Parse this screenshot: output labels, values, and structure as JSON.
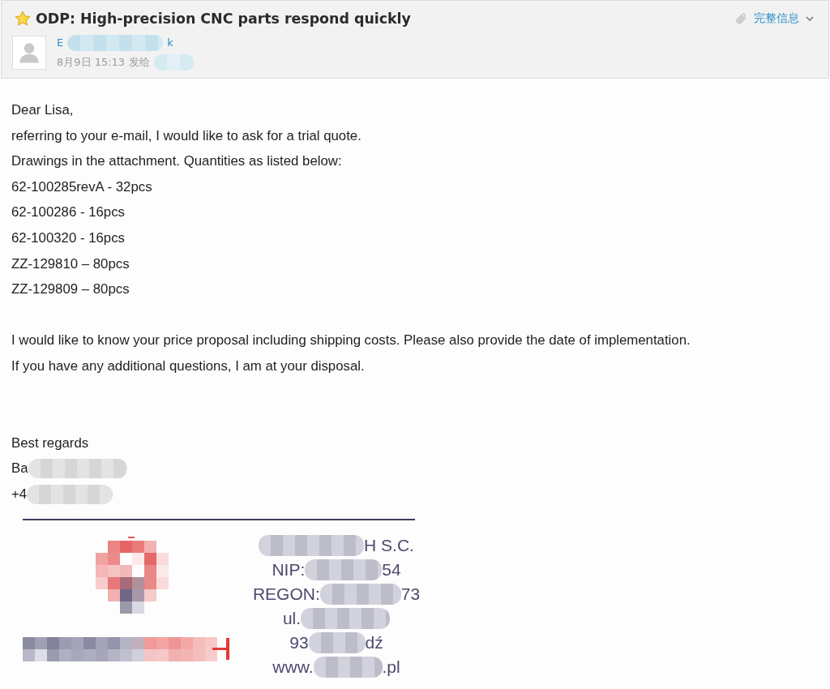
{
  "header": {
    "starred": true,
    "subject": "ODP: High-precision CNC parts respond quickly",
    "sender_name_parts": [
      "E",
      "k"
    ],
    "date": "8月9日 15:13",
    "sent_to_label": "发给",
    "has_attachment": true,
    "details_link": "完整信息",
    "details_expanded": false
  },
  "body": {
    "paragraphs": [
      {
        "lines": [
          "Dear Lisa,",
          "referring to your e-mail, I would like to ask for a trial quote.",
          "Drawings in the attachment. Quantities as listed below:",
          "62-100285revA - 32pcs",
          "62-100286 - 16pcs",
          "62-100320 - 16pcs",
          "ZZ-129810 – 80pcs",
          "ZZ-129809 – 80pcs"
        ]
      },
      {
        "lines": [
          "I would like to know your price proposal including shipping costs. Please also provide the date of implementation.",
          "If you have any additional questions, I am at your disposal."
        ]
      }
    ]
  },
  "signature": {
    "closing": "Best regards",
    "name_start": "Ba",
    "phone_start": "+4",
    "card_lines": [
      {
        "end": "H S.C."
      },
      {
        "start": "NIP:",
        "end": "54"
      },
      {
        "start": "REGON:",
        "end": "73"
      },
      {
        "start": "ul."
      },
      {
        "start": "93",
        "end": "dź"
      },
      {
        "start": "www.",
        "end": ".pl"
      }
    ]
  }
}
